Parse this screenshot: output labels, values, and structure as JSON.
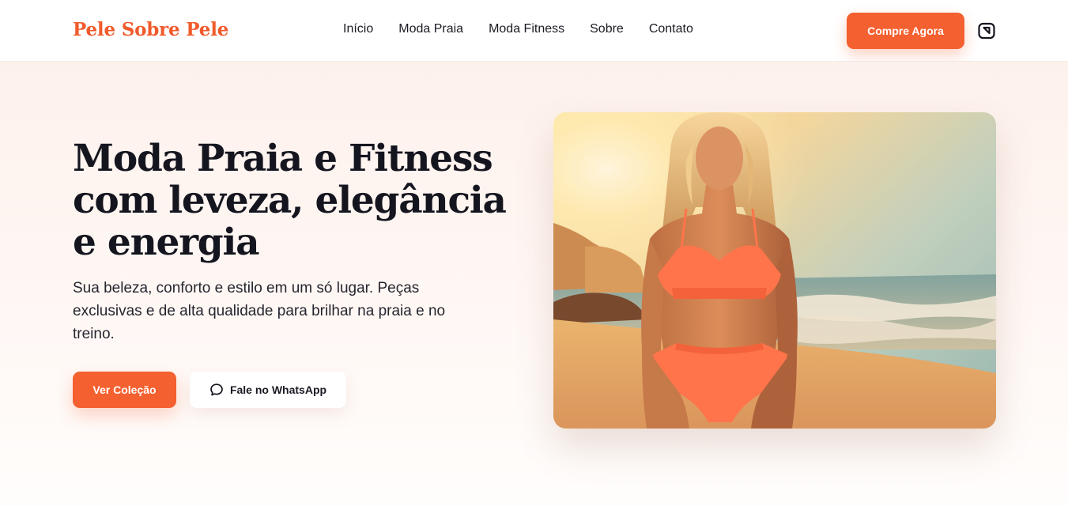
{
  "brand": {
    "name": "Pele Sobre Pele",
    "accent": "#f4602f"
  },
  "nav": {
    "items": [
      {
        "label": "Início"
      },
      {
        "label": "Moda Praia"
      },
      {
        "label": "Moda Fitness"
      },
      {
        "label": "Sobre"
      },
      {
        "label": "Contato"
      }
    ],
    "cta_label": "Compre Agora",
    "cart_icon": "shopping-bag-icon"
  },
  "hero": {
    "title": "Moda Praia e Fitness com leveza, elegância e energia",
    "subtitle": "Sua beleza, conforto e estilo em um só lugar. Peças exclusivas e de alta qualidade para brilhar na praia e no treino.",
    "primary_button": "Ver Coleção",
    "secondary_button": "Fale no WhatsApp",
    "secondary_icon": "chat-bubble-icon",
    "image_subject": "woman-in-orange-bikini-on-beach-at-sunset"
  }
}
